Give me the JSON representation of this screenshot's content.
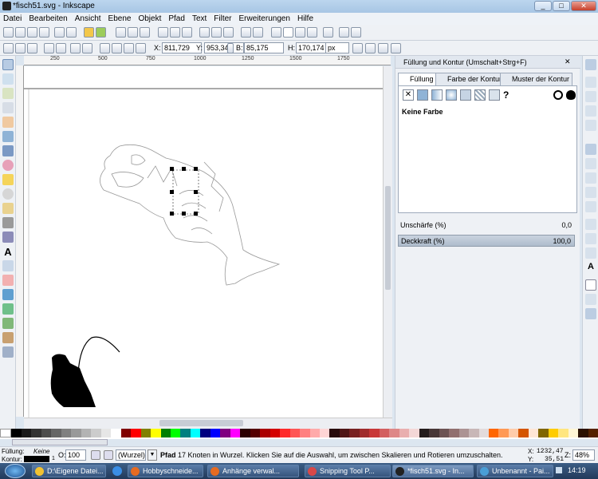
{
  "window": {
    "title": "*fisch51.svg - Inkscape",
    "min": "_",
    "max": "□",
    "close": "✕"
  },
  "menu": [
    "Datei",
    "Bearbeiten",
    "Ansicht",
    "Ebene",
    "Objekt",
    "Pfad",
    "Text",
    "Filter",
    "Erweiterungen",
    "Hilfe"
  ],
  "coords": {
    "x_label": "X:",
    "x": "811,729",
    "y_label": "Y:",
    "y": "953,342",
    "w_label": "B:",
    "w": "85,175",
    "h_label": "H:",
    "h": "170,174",
    "unit": "px"
  },
  "ruler": [
    "250",
    "500",
    "750",
    "1000",
    "1250",
    "1500",
    "1750"
  ],
  "panel": {
    "title": "Füllung und Kontur (Umschalt+Strg+F)",
    "tabs": [
      "Füllung",
      "Farbe der Kontur",
      "Muster der Kontur"
    ],
    "unknown_label": "?",
    "fill_state": "Keine Farbe",
    "blur_label": "Unschärfe (%)",
    "blur_value": "0,0",
    "opacity_label": "Deckkraft (%)",
    "opacity_value": "100,0"
  },
  "status": {
    "fill_label": "Füllung:",
    "fill_value": "Keine",
    "stroke_label": "Kontur:",
    "stroke_width": "1",
    "o_label": "O:",
    "opacity": "100",
    "layer": "(Wurzel)",
    "message_bold": "Pfad",
    "message": "17 Knoten in Wurzel. Klicken Sie auf die Auswahl, um zwischen Skalieren und Rotieren umzuschalten.",
    "cx_label": "X:",
    "cx": "1232,47",
    "cy_label": "Y:",
    "cy": "35,51",
    "zoom_label": "Z:",
    "zoom": "48%"
  },
  "taskbar": {
    "items": [
      "D:\\Eigene Datei...",
      "Hobbyschneide...",
      "Anhänge verwal...",
      "Snipping Tool P...",
      "*fisch51.svg - In...",
      "Unbenannt - Pai..."
    ],
    "clock": "14:19"
  },
  "colors": {
    "accent": "#3a6ea5"
  }
}
